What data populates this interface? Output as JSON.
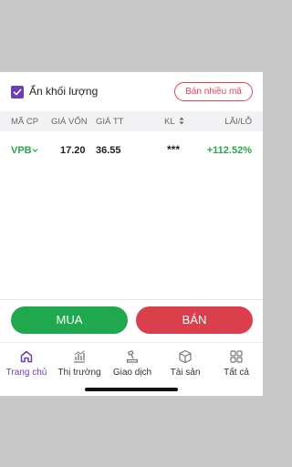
{
  "toolbar": {
    "hide_volume_label": "Ẩn khối lượng",
    "hide_volume_checked": true,
    "sell_multiple_label": "Bán nhiều mã"
  },
  "table": {
    "headers": [
      "MÃ CP",
      "GIÁ VỐN",
      "GIÁ TT",
      "KL",
      "LÃI/LỖ"
    ],
    "rows": [
      {
        "symbol": "VPB",
        "avg_price": "17.20",
        "market_price": "36.55",
        "quantity": "***",
        "profit_loss": "+112.52%"
      }
    ]
  },
  "actions": {
    "buy_label": "MUA",
    "sell_label": "BÁN"
  },
  "tabs": [
    {
      "label": "Trang chủ",
      "icon": "home-icon",
      "active": true
    },
    {
      "label": "Thị trường",
      "icon": "market-chart-icon",
      "active": false
    },
    {
      "label": "Giao dịch",
      "icon": "gavel-icon",
      "active": false
    },
    {
      "label": "Tài sản",
      "icon": "box-icon",
      "active": false
    },
    {
      "label": "Tất cả",
      "icon": "grid-icon",
      "active": false
    }
  ],
  "colors": {
    "accent": "#6b3fb5",
    "buy": "#1fa84e",
    "sell": "#d9404b",
    "gain": "#2aa64a"
  }
}
